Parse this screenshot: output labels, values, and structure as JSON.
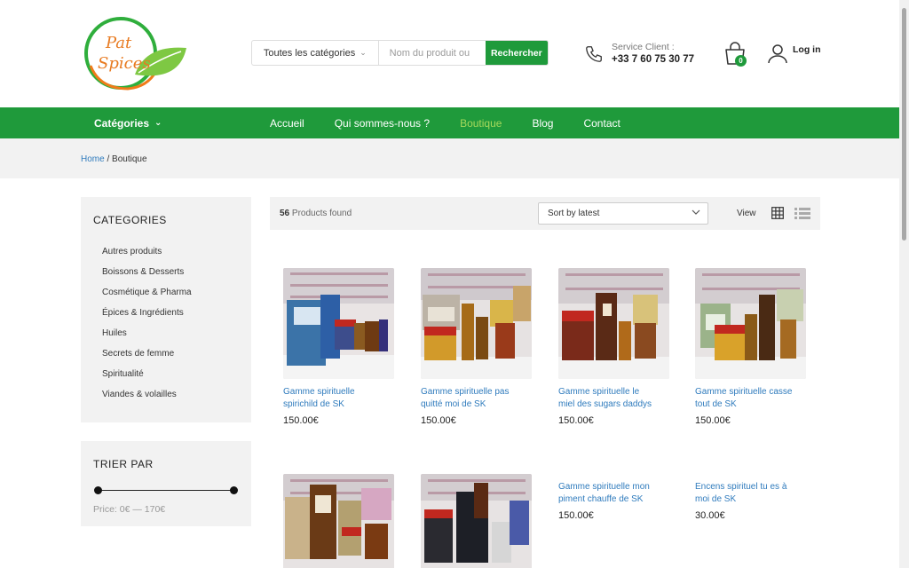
{
  "logo": {
    "line1": "Pat",
    "line2": "Spices"
  },
  "search": {
    "category": "Toutes les catégories",
    "placeholder": "Nom du produit ou",
    "button": "Rechercher"
  },
  "service": {
    "label": "Service Client :",
    "phone": "+33 7 60 75 30 77"
  },
  "cart": {
    "count": "0"
  },
  "account": {
    "login": "Log in"
  },
  "nav": {
    "categories": "Catégories",
    "links": [
      {
        "label": "Accueil",
        "active": false
      },
      {
        "label": "Qui sommes-nous ?",
        "active": false
      },
      {
        "label": "Boutique",
        "active": true
      },
      {
        "label": "Blog",
        "active": false
      },
      {
        "label": "Contact",
        "active": false
      }
    ]
  },
  "breadcrumb": {
    "home": "Home",
    "separator": "/",
    "current": "Boutique"
  },
  "sidebar": {
    "categories_title": "CATEGORIES",
    "categories": [
      "Autres produits",
      "Boissons & Desserts",
      "Cosmétique & Pharma",
      "Épices & Ingrédients",
      "Huiles",
      "Secrets de femme",
      "Spiritualité",
      "Viandes & volailles"
    ],
    "filter_title": "TRIER PAR",
    "price_label": "Price: 0€ — 170€",
    "price_range": [
      0,
      170
    ]
  },
  "toolbar": {
    "count": "56",
    "found_label": "Products found",
    "sort": "Sort by latest",
    "view_label": "View"
  },
  "products": [
    {
      "name_line1": "Gamme spirituelle",
      "name_line2": "spirichild de SK",
      "price": "150.00€",
      "has_image": true
    },
    {
      "name_line1": "Gamme spirituelle pas",
      "name_line2": "quitté moi de SK",
      "price": "150.00€",
      "has_image": true
    },
    {
      "name_line1": "Gamme spirituelle le",
      "name_line2": "miel des sugars daddys",
      "price": "150.00€",
      "has_image": true
    },
    {
      "name_line1": "Gamme spirituelle casse",
      "name_line2": "tout de SK",
      "price": "150.00€",
      "has_image": true
    },
    {
      "name_line1": "",
      "name_line2": "",
      "price": "",
      "has_image": true
    },
    {
      "name_line1": "",
      "name_line2": "",
      "price": "",
      "has_image": true
    },
    {
      "name_line1": "Gamme spirituelle mon",
      "name_line2": "piment chauffe de SK",
      "price": "150.00€",
      "has_image": false
    },
    {
      "name_line1": "Encens spirituel tu es à",
      "name_line2": "moi de SK",
      "price": "30.00€",
      "has_image": false
    }
  ],
  "colors": {
    "brand_green": "#1f9a3b",
    "nav_active": "#a6d95b",
    "link_blue": "#2f7bbd"
  }
}
